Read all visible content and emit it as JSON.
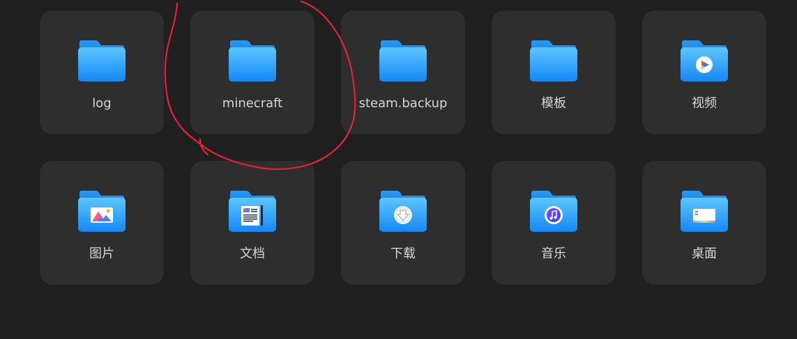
{
  "accent_folder": "#2ea3ff",
  "annotation_color": "#e8203a",
  "folders": [
    {
      "label": "log",
      "icon": "folder-icon"
    },
    {
      "label": "minecraft",
      "icon": "folder-icon"
    },
    {
      "label": "steam.backup",
      "icon": "folder-icon"
    },
    {
      "label": "模板",
      "icon": "folder-icon"
    },
    {
      "label": "视频",
      "icon": "video-folder-icon"
    },
    {
      "label": "图片",
      "icon": "pictures-folder-icon"
    },
    {
      "label": "文档",
      "icon": "documents-folder-icon"
    },
    {
      "label": "下载",
      "icon": "downloads-folder-icon"
    },
    {
      "label": "音乐",
      "icon": "music-folder-icon"
    },
    {
      "label": "桌面",
      "icon": "desktop-folder-icon"
    }
  ]
}
